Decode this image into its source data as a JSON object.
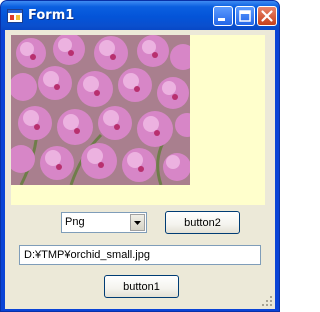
{
  "window": {
    "title": "Form1"
  },
  "picturebox": {
    "image": "orchid-photo"
  },
  "format_combo": {
    "selected": "Png"
  },
  "button2": {
    "label": "button2"
  },
  "path_field": {
    "value": "D:¥TMP¥orchid_small.jpg"
  },
  "button1": {
    "label": "button1"
  },
  "colors": {
    "title_bar": "#0454d8",
    "client_bg": "#ece9d8",
    "picturebox_bg": "#ffffcc",
    "close_button": "#c5401b"
  }
}
